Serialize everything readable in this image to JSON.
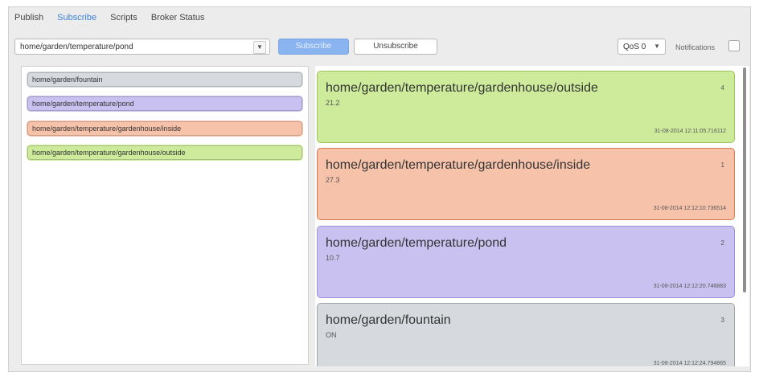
{
  "tabs": [
    {
      "label": "Publish"
    },
    {
      "label": "Subscribe"
    },
    {
      "label": "Scripts"
    },
    {
      "label": "Broker Status"
    }
  ],
  "toolbar": {
    "topic_value": "home/garden/temperature/pond",
    "subscribe_label": "Subscribe",
    "unsubscribe_label": "Unsubscribe",
    "qos_value": "QoS 0",
    "notifications_label": "Notifications",
    "notifications_checked": false
  },
  "topics": [
    {
      "name": "home/garden/fountain",
      "color": "#d6d9de"
    },
    {
      "name": "home/garden/temperature/pond",
      "color": "#c9c2f0"
    },
    {
      "name": "home/garden/temperature/gardenhouse/inside",
      "color": "#f7c2aa"
    },
    {
      "name": "home/garden/temperature/gardenhouse/outside",
      "color": "#cdeb9b"
    }
  ],
  "messages": [
    {
      "topic": "home/garden/temperature/gardenhouse/outside",
      "payload": "21.2",
      "count": "4",
      "timestamp": "31-08-2014  12:11:05.716112",
      "color": "#cdeb9b",
      "border": "#9cc35a"
    },
    {
      "topic": "home/garden/temperature/gardenhouse/inside",
      "payload": "27.3",
      "count": "1",
      "timestamp": "31-08-2014  12:12:10.736514",
      "color": "#f7c2aa",
      "border": "#d9784f"
    },
    {
      "topic": "home/garden/temperature/pond",
      "payload": "10.7",
      "count": "2",
      "timestamp": "31-08-2014  12:12:20.746883",
      "color": "#c9c2f0",
      "border": "#9a8fd8"
    },
    {
      "topic": "home/garden/fountain",
      "payload": "ON",
      "count": "3",
      "timestamp": "31-08-2014  12:12:24.794865",
      "color": "#d6d9de",
      "border": "#9ea3aa"
    }
  ]
}
